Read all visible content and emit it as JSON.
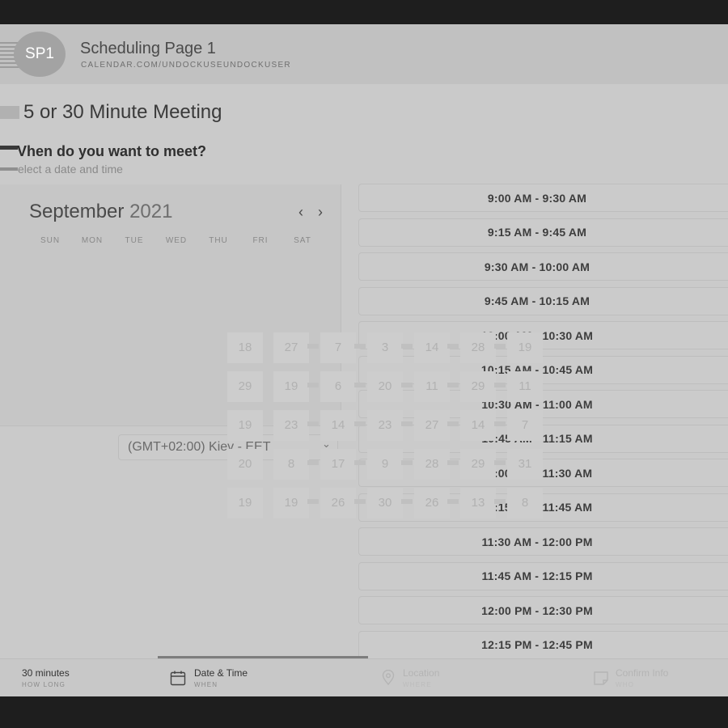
{
  "header": {
    "avatar_initials": "SP1",
    "title": "Scheduling Page 1",
    "url": "CALENDAR.COM/UNDOCKUSEUNDOCKUSER"
  },
  "meeting": {
    "title": "5 or 30 Minute Meeting",
    "question": "Vhen do you want to meet?",
    "instruction": "elect a date and time"
  },
  "calendar": {
    "month": "September",
    "year": "2021",
    "prev_icon": "chevron-left-icon",
    "next_icon": "chevron-right-icon",
    "weekdays": [
      "SUN",
      "MON",
      "TUE",
      "WED",
      "THU",
      "FRI",
      "SAT"
    ],
    "glitched_days": [
      "18",
      "27",
      "7",
      "3",
      "14",
      "28",
      "19",
      "29",
      "19",
      "6",
      "20",
      "11",
      "29",
      "11",
      "19",
      "23",
      "14",
      "23",
      "27",
      "14",
      "7",
      "20",
      "8",
      "17",
      "9",
      "28",
      "29",
      "31",
      "19",
      "19",
      "26",
      "30",
      "26",
      "13",
      "8"
    ]
  },
  "timezone": {
    "value": "(GMT+02:00) Kiev - EET"
  },
  "time_slots": [
    "9:00 AM - 9:30 AM",
    "9:15 AM - 9:45 AM",
    "9:30 AM - 10:00 AM",
    "9:45 AM - 10:15 AM",
    "10:00 AM - 10:30 AM",
    "10:15 AM - 10:45 AM",
    "10:30 AM - 11:00 AM",
    "10:45 AM - 11:15 AM",
    "11:00 AM - 11:30 AM",
    "11:15 AM - 11:45 AM",
    "11:30 AM - 12:00 PM",
    "11:45 AM - 12:15 PM",
    "12:00 PM - 12:30 PM",
    "12:15 PM - 12:45 PM"
  ],
  "steps": [
    {
      "label": "30 minutes",
      "sub": "HOW LONG",
      "icon": ""
    },
    {
      "label": "Date & Time",
      "sub": "WHEN",
      "icon": "calendar-icon"
    },
    {
      "label": "Location",
      "sub": "WHERE",
      "icon": "location-pin-icon"
    },
    {
      "label": "Confirm Info",
      "sub": "WHO",
      "icon": "note-icon"
    }
  ],
  "colors": {
    "background": "#cacaca",
    "header": "#c1c1c1",
    "frame": "#1e1e1e"
  }
}
